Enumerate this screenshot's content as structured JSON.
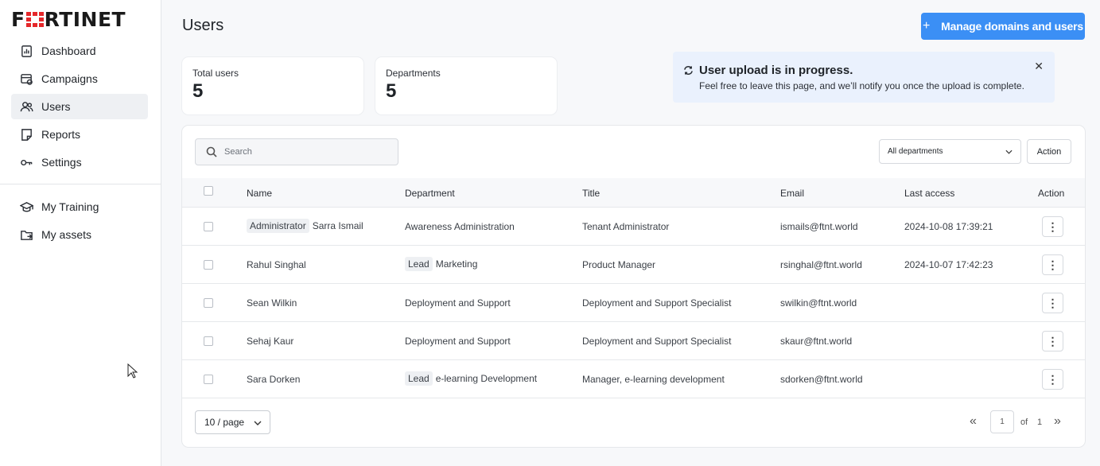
{
  "brand": {
    "logo_text": "FORTINET",
    "accent": "#e5272a"
  },
  "sidebar": {
    "items": [
      {
        "label": "Dashboard",
        "icon": "dashboard-icon"
      },
      {
        "label": "Campaigns",
        "icon": "campaigns-icon"
      },
      {
        "label": "Users",
        "icon": "users-icon",
        "active": true
      },
      {
        "label": "Reports",
        "icon": "reports-icon"
      },
      {
        "label": "Settings",
        "icon": "settings-icon"
      }
    ],
    "secondary_items": [
      {
        "label": "My Training",
        "icon": "training-icon"
      },
      {
        "label": "My assets",
        "icon": "assets-icon"
      }
    ]
  },
  "header": {
    "title": "Users",
    "manage_button": "Manage domains and users",
    "manage_button_color": "#3b8ff5"
  },
  "stats": {
    "total_users": {
      "label": "Total users",
      "value": "5"
    },
    "departments": {
      "label": "Departments",
      "value": "5"
    }
  },
  "banner": {
    "title": "User upload is in progress.",
    "text": "Feel free to leave this page, and we’ll notify you once the upload is complete.",
    "close": "✕",
    "background": "#eaf1fd"
  },
  "toolbar": {
    "search_placeholder": "Search",
    "department_filter": "All departments",
    "action_label": "Action"
  },
  "table": {
    "columns": [
      "Name",
      "Department",
      "Title",
      "Email",
      "Last access",
      "Action"
    ],
    "rows": [
      {
        "name_tag": "Administrator",
        "name": "Sarra Ismail",
        "dept_tag": "",
        "department": "Awareness Administration",
        "title": "Tenant Administrator",
        "email": "ismails@ftnt.world",
        "last_access": "2024-10-08 17:39:21"
      },
      {
        "name_tag": "",
        "name": "Rahul Singhal",
        "dept_tag": "Lead",
        "department": "Marketing",
        "title": "Product Manager",
        "email": "rsinghal@ftnt.world",
        "last_access": "2024-10-07 17:42:23"
      },
      {
        "name_tag": "",
        "name": "Sean Wilkin",
        "dept_tag": "",
        "department": "Deployment and Support",
        "title": "Deployment and Support Specialist",
        "email": "swilkin@ftnt.world",
        "last_access": ""
      },
      {
        "name_tag": "",
        "name": "Sehaj Kaur",
        "dept_tag": "",
        "department": "Deployment and Support",
        "title": "Deployment and Support Specialist",
        "email": "skaur@ftnt.world",
        "last_access": ""
      },
      {
        "name_tag": "",
        "name": "Sara Dorken",
        "dept_tag": "Lead",
        "department": "e-learning Development",
        "title": "Manager, e-learning development",
        "email": "sdorken@ftnt.world",
        "last_access": ""
      }
    ]
  },
  "pagination": {
    "page_size": "10 / page",
    "current_page": "1",
    "of_label": "of",
    "total_pages": "1",
    "first": "«",
    "last": "»"
  }
}
